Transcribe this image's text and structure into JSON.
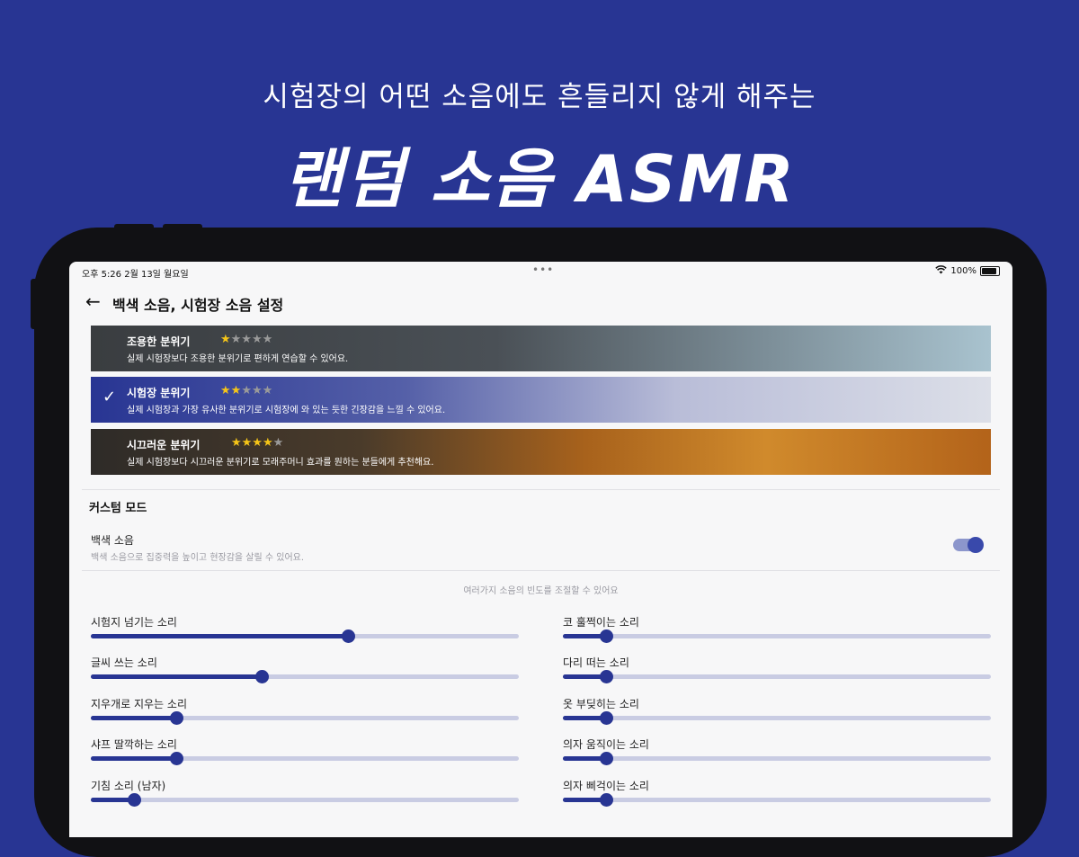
{
  "promo": {
    "subtitle": "시험장의 어떤 소음에도 흔들리지 않게 해주는",
    "title": "랜덤 소음 ASMR"
  },
  "status_bar": {
    "time": "오후 5:26   2월 13일 월요일",
    "dots": "•••",
    "battery": "100%"
  },
  "header": {
    "back_icon": "←",
    "title": "백색 소음, 시험장 소음 설정"
  },
  "presets": [
    {
      "title": "조용한 분위기",
      "stars": 1,
      "max_stars": 5,
      "description": "실제 시험장보다 조용한 분위기로 편하게 연습할 수 있어요.",
      "selected": false
    },
    {
      "title": "시험장 분위기",
      "stars": 2,
      "max_stars": 5,
      "description": "실제 시험장과 가장 유사한 분위기로 시험장에 와 있는 듯한 긴장감을 느낄 수 있어요.",
      "selected": true
    },
    {
      "title": "시끄러운 분위기",
      "stars": 4,
      "max_stars": 5,
      "description": "실제 시험장보다 시끄러운 분위기로 모래주머니 효과를 원하는 분들에게 추천해요.",
      "selected": false
    }
  ],
  "check_icon": "✓",
  "custom": {
    "section_title": "커스텀 모드",
    "white_noise_label": "백색 소음",
    "white_noise_desc": "백색 소음으로 집중력을 높이고 현장감을 살릴 수 있어요.",
    "white_noise_on": true,
    "frequency_hint": "여러가지 소음의 빈도를 조절할 수 있어요"
  },
  "sliders_left": [
    {
      "label": "시험지 넘기는 소리",
      "value": 0.6
    },
    {
      "label": "글씨 쓰는 소리",
      "value": 0.4
    },
    {
      "label": "지우개로 지우는 소리",
      "value": 0.2
    },
    {
      "label": "샤프 딸깍하는 소리",
      "value": 0.2
    },
    {
      "label": "기침 소리 (남자)",
      "value": 0.1
    }
  ],
  "sliders_right": [
    {
      "label": "코 훌쩍이는 소리",
      "value": 0.1
    },
    {
      "label": "다리 떠는 소리",
      "value": 0.1
    },
    {
      "label": "옷 부딪히는 소리",
      "value": 0.1
    },
    {
      "label": "의자 움직이는 소리",
      "value": 0.1
    },
    {
      "label": "의자 삐걱이는 소리",
      "value": 0.1
    }
  ],
  "colors": {
    "brand": "#283593",
    "track": "#c9cce3",
    "star": "#f5c518"
  }
}
